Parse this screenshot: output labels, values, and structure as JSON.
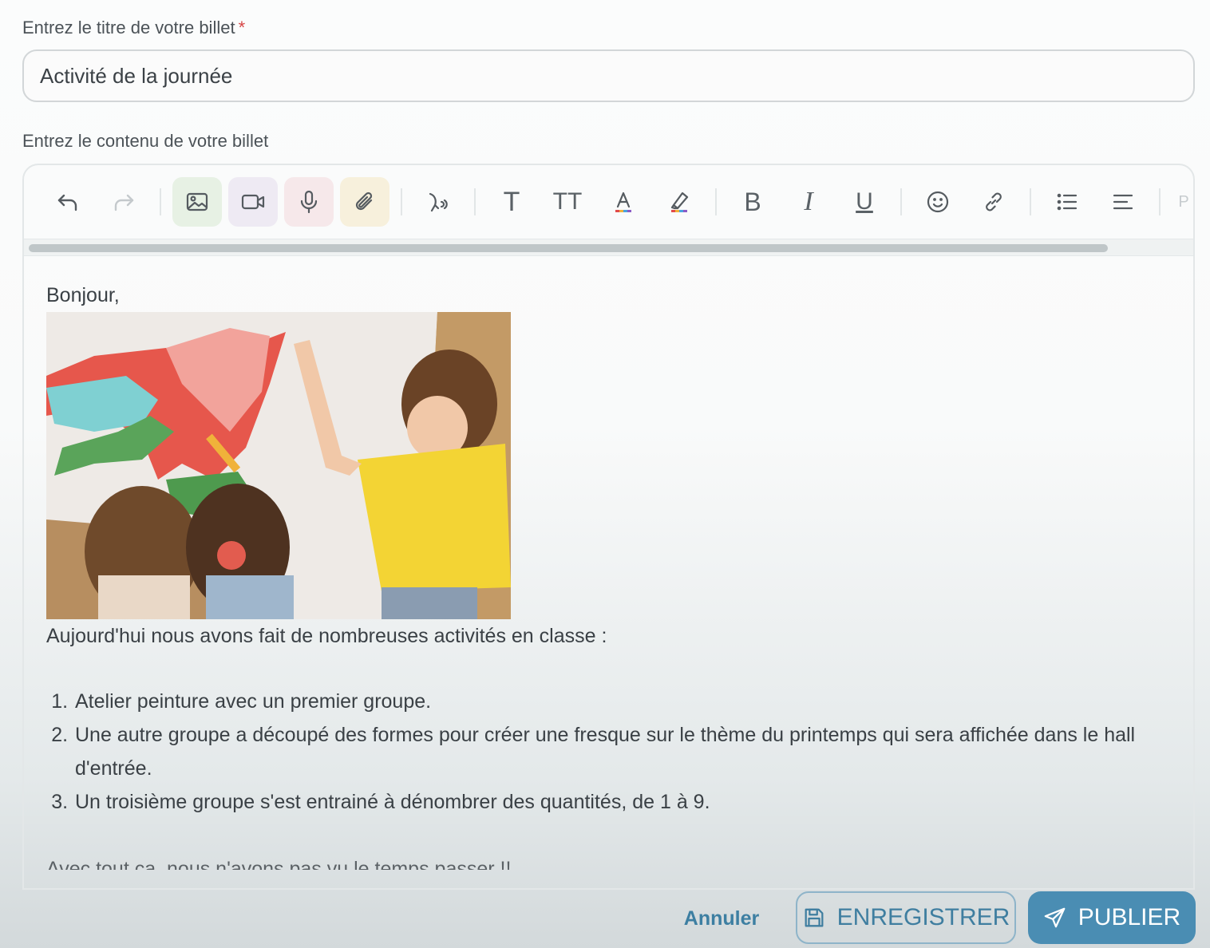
{
  "title_field": {
    "label": "Entrez le titre de votre billet",
    "required_mark": "*",
    "value": "Activité de la journée"
  },
  "content_field": {
    "label": "Entrez le contenu de votre billet"
  },
  "toolbar": {
    "text_label": "T",
    "text_size_label": "TT",
    "text_color_label": "A",
    "bold_label": "B",
    "italic_label": "I",
    "underline_label": "U",
    "cut_label": "P",
    "scrollbar_position": 0.92
  },
  "content": {
    "greeting": "Bonjour,",
    "intro": "Aujourd'hui nous avons fait de nombreuses activités en classe :",
    "items": [
      "Atelier peinture avec un premier groupe.",
      "Une autre groupe a découpé des formes pour créer une fresque sur le thème du printemps qui sera affichée dans le hall d'entrée.",
      "Un troisième groupe s'est entrainé à dénombrer des quantités, de 1 à 9."
    ],
    "closing": "Avec tout ça, nous n'avons pas vu le temps passer !!"
  },
  "footer": {
    "cancel_label": "Annuler",
    "save_label": "ENREGISTRER",
    "publish_label": "PUBLIER"
  },
  "colors": {
    "accent": "#4a8db3",
    "accent_text": "#3f7ea0",
    "required": "#d64545"
  }
}
